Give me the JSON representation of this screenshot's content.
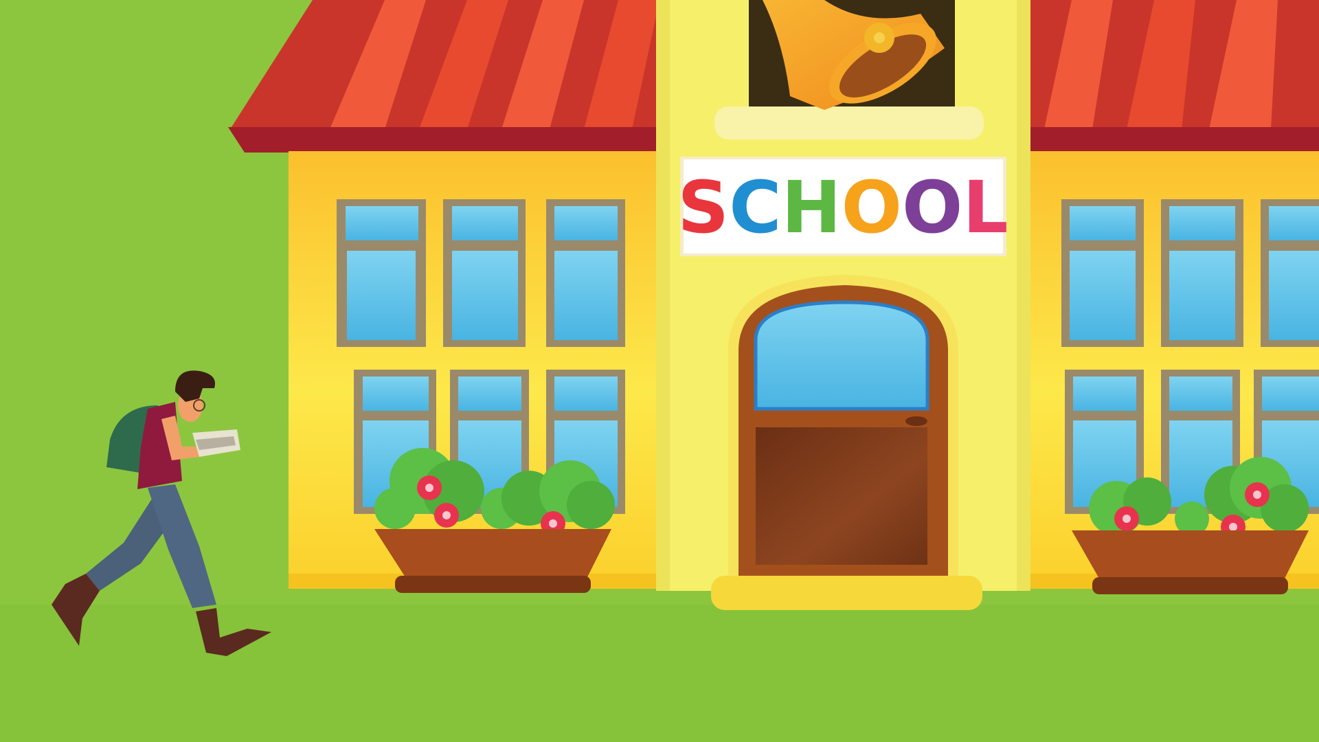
{
  "scene": {
    "sign": {
      "letters": [
        {
          "char": "S",
          "color": "#e8363c"
        },
        {
          "char": "C",
          "color": "#1f8fd1"
        },
        {
          "char": "H",
          "color": "#5db843"
        },
        {
          "char": "O",
          "color": "#f7a21b"
        },
        {
          "char": "O",
          "color": "#7d3f98"
        },
        {
          "char": "L",
          "color": "#e83e6c"
        }
      ]
    },
    "colors": {
      "grass": "#8cc63f",
      "wall": "#fcd22e",
      "tower": "#f6ef6a",
      "roof_dark": "#c83a2b",
      "roof_light": "#f05a3a",
      "window_glass": "#5cc2e8",
      "window_frame": "#9a8a6a",
      "door": "#a4501c",
      "planter": "#a84d1e",
      "bush": "#5cbf46",
      "flower": "#e8334f",
      "bell": "#f5a623"
    }
  }
}
